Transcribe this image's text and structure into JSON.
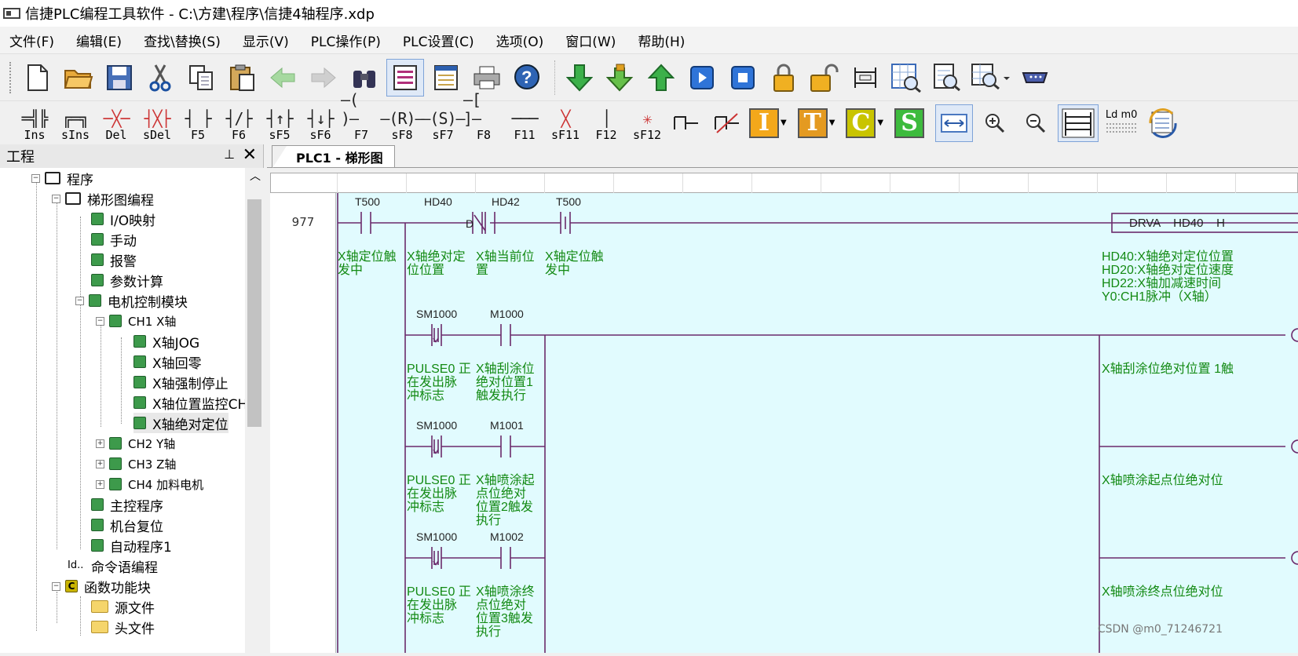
{
  "window": {
    "title": "信捷PLC编程工具软件 - C:\\方建\\程序\\信捷4轴程序.xdp"
  },
  "menu": [
    "文件(F)",
    "编辑(E)",
    "查找\\替换(S)",
    "显示(V)",
    "PLC操作(P)",
    "PLC设置(C)",
    "选项(O)",
    "窗口(W)",
    "帮助(H)"
  ],
  "toolbar1": {
    "icons": [
      "new-file-icon",
      "open-folder-icon",
      "save-icon",
      "cut-icon",
      "copy-icon",
      "paste-icon",
      "undo-arrow-icon",
      "redo-arrow-icon",
      "find-binoculars-icon",
      "ladder-view-icon",
      "list-view-icon",
      "print-icon",
      "help-icon",
      "download-icon",
      "download-lock-icon",
      "upload-icon",
      "run-icon",
      "stop-icon",
      "lock-icon",
      "unlock-icon",
      "monitor-icon",
      "table-zoom-icon",
      "document-zoom-icon",
      "zoom-dropdown-icon",
      "serial-port-icon"
    ]
  },
  "toolbar2": {
    "labels": [
      "Ins",
      "sIns",
      "Del",
      "sDel",
      "F5",
      "F6",
      "sF5",
      "sF6",
      "F7",
      "sF8",
      "sF7",
      "F8",
      "F11",
      "sF11",
      "F12",
      "sF12"
    ],
    "glyphs": [
      "═╣╠",
      "╔═╗",
      "─╳─",
      "┤╳├",
      "┤ ├",
      "┤/├",
      "┤↑├",
      "┤↓├",
      "―( )―",
      "―(R)―",
      "―(S)―",
      "―[ ]―",
      "───",
      "╳",
      "│",
      "✳"
    ],
    "letters": [
      "I",
      "T",
      "C",
      "S"
    ],
    "ld_label": "Ld m0"
  },
  "colors": {
    "accent_I": "#f3a81b",
    "accent_T": "#e49a21",
    "accent_C": "#c9c400",
    "accent_S": "#3dbb3d",
    "ladder_bg": "#e1fbfe",
    "comment": "#138a13"
  },
  "project_panel": {
    "title": "工程",
    "pin": "♀",
    "close": "✕",
    "items": [
      {
        "label": "程序"
      },
      {
        "label": "梯形图编程"
      },
      {
        "label": "I/O映射"
      },
      {
        "label": "手动"
      },
      {
        "label": "报警"
      },
      {
        "label": "参数计算"
      },
      {
        "label": "电机控制模块"
      },
      {
        "label": "CH1 X轴"
      },
      {
        "label": "X轴JOG"
      },
      {
        "label": "X轴回零"
      },
      {
        "label": "X轴强制停止"
      },
      {
        "label": "X轴位置监控CH"
      },
      {
        "label": "X轴绝对定位"
      },
      {
        "label": "CH2 Y轴"
      },
      {
        "label": "CH3 Z轴"
      },
      {
        "label": "CH4 加料电机"
      },
      {
        "label": "主控程序"
      },
      {
        "label": "机台复位"
      },
      {
        "label": "自动程序1"
      },
      {
        "label": "命令语编程"
      },
      {
        "label": "函数功能块"
      },
      {
        "label": "源文件"
      },
      {
        "label": "头文件"
      }
    ]
  },
  "editor": {
    "tab": "PLC1 - 梯形图",
    "rung_number": "977",
    "row1_contacts": [
      "T500",
      "HD40",
      "HD42",
      "T500"
    ],
    "d_label": "D",
    "instr": "DRVA    HD40    H",
    "row1_comments": [
      "X轴定位触\n发中",
      "X轴绝对定\n位位置",
      "X轴当前位\n置",
      "X轴定位触\n发中"
    ],
    "drva_comments": [
      "HD40:X轴绝对定位位置",
      "HD20:X轴绝对定位速度",
      "HD22:X轴加减速时间",
      "Y0:CH1脉冲（X轴）"
    ],
    "sub_rungs": [
      {
        "c1": "SM1000",
        "c2": "M1000",
        "cm1": [
          "PULSE0 正",
          "在发出脉",
          "冲标志"
        ],
        "cm2": [
          "X轴刮涂位",
          "绝对位置1",
          "触发执行"
        ],
        "right": "X轴刮涂位绝对位置 1触"
      },
      {
        "c1": "SM1000",
        "c2": "M1001",
        "cm1": [
          "PULSE0 正",
          "在发出脉",
          "冲标志"
        ],
        "cm2": [
          "X轴喷涂起",
          "点位绝对",
          "位置2触发",
          "执行"
        ],
        "right": "X轴喷涂起点位绝对位"
      },
      {
        "c1": "SM1000",
        "c2": "M1002",
        "cm1": [
          "PULSE0 正",
          "在发出脉",
          "冲标志"
        ],
        "cm2": [
          "X轴喷涂终",
          "点位绝对",
          "位置3触发",
          "执行"
        ],
        "right": "X轴喷涂终点位绝对位"
      }
    ]
  },
  "watermark": "CSDN @m0_71246721"
}
